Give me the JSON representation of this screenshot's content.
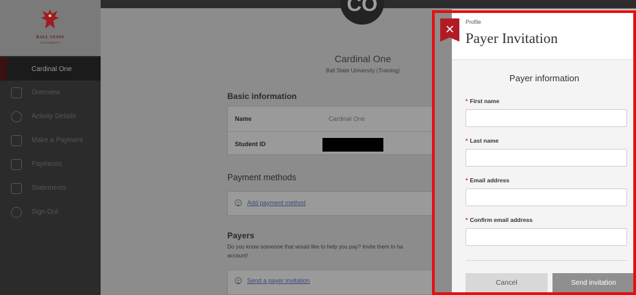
{
  "sidebar": {
    "logo": {
      "line1": "BALL STATE",
      "line2": "UNIVERSITY"
    },
    "items": [
      {
        "label": "Cardinal One",
        "icon": "user-icon"
      },
      {
        "label": "Overview",
        "icon": "home-icon"
      },
      {
        "label": "Activity Details",
        "icon": "clock-icon"
      },
      {
        "label": "Make a Payment",
        "icon": "payment-icon"
      },
      {
        "label": "Payments",
        "icon": "dollar-icon"
      },
      {
        "label": "Statements",
        "icon": "statement-icon"
      },
      {
        "label": "Sign Out",
        "icon": "sign-out-icon"
      }
    ]
  },
  "profile": {
    "initials": "CO",
    "name": "Cardinal One",
    "subtitle": "Ball State University (Training)"
  },
  "basic_info": {
    "title": "Basic information",
    "name_label": "Name",
    "name_value": "Cardinal One",
    "student_id_label": "Student ID"
  },
  "payment_methods": {
    "title": "Payment methods",
    "add_link": "Add payment method"
  },
  "payers": {
    "title": "Payers",
    "description_line1": "Do you know someone that would like to help you pay? Invite them to ha",
    "description_line2": "account!",
    "invite_link": "Send a payer invitation"
  },
  "modal": {
    "eyebrow": "Profile",
    "title": "Payer Invitation",
    "close_label": "×",
    "section_title": "Payer information",
    "required_mark": "*",
    "fields": [
      {
        "label": "First name",
        "value": ""
      },
      {
        "label": "Last name",
        "value": ""
      },
      {
        "label": "Email address",
        "value": ""
      },
      {
        "label": "Confirm email address",
        "value": ""
      }
    ],
    "cancel_label": "Cancel",
    "send_label": "Send invitation"
  },
  "colors": {
    "brand_red": "#b31b24",
    "highlight": "#e31010"
  }
}
